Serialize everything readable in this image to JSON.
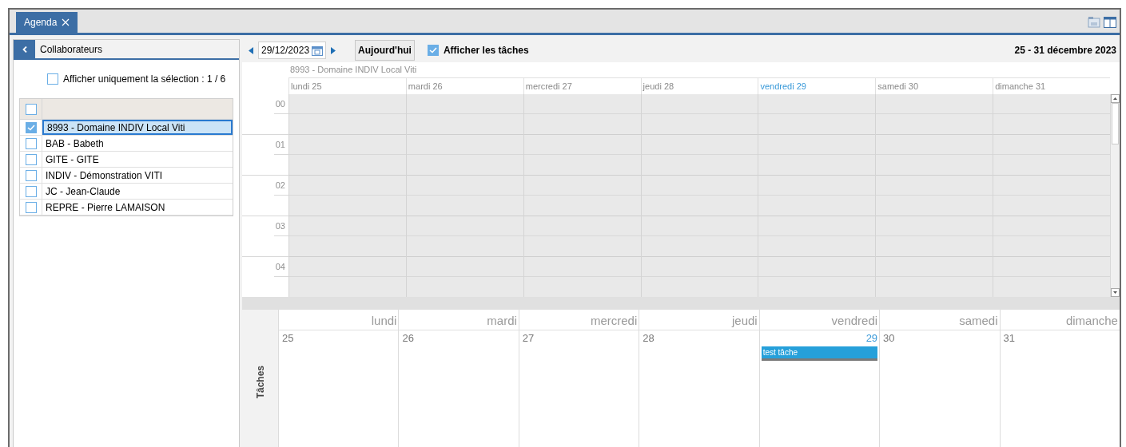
{
  "tab": {
    "label": "Agenda",
    "selected": true
  },
  "sidebar": {
    "title": "Collaborateurs",
    "show_selection_only": {
      "label": "Afficher uniquement la sélection : 1 / 6",
      "checked": false
    },
    "select_all_checked": false,
    "collaborators": [
      {
        "label": "8993 - Domaine INDIV Local Viti",
        "checked": true,
        "selected": true
      },
      {
        "label": "BAB - Babeth",
        "checked": false,
        "selected": false
      },
      {
        "label": "GITE - GITE",
        "checked": false,
        "selected": false
      },
      {
        "label": "INDIV - Démonstration VITI",
        "checked": false,
        "selected": false
      },
      {
        "label": "JC - Jean-Claude",
        "checked": false,
        "selected": false
      },
      {
        "label": "REPRE - Pierre LAMAISON",
        "checked": false,
        "selected": false
      }
    ]
  },
  "toolbar": {
    "date": "29/12/2023",
    "today_button": "Aujourd'hui",
    "show_tasks": {
      "label": "Afficher les tâches",
      "checked": true
    },
    "range": "25  - 31 décembre 2023"
  },
  "schedule": {
    "owner": "8993 - Domaine INDIV Local Viti",
    "hours": [
      "00",
      "01",
      "02",
      "03",
      "04"
    ],
    "days": [
      {
        "label": "lundi 25",
        "today": false
      },
      {
        "label": "mardi 26",
        "today": false
      },
      {
        "label": "mercredi 27",
        "today": false
      },
      {
        "label": "jeudi 28",
        "today": false
      },
      {
        "label": "vendredi 29",
        "today": true
      },
      {
        "label": "samedi 30",
        "today": false
      },
      {
        "label": "dimanche 31",
        "today": false
      }
    ]
  },
  "tasks": {
    "label": "Tâches",
    "days": [
      {
        "name": "lundi",
        "number": "25",
        "today": false
      },
      {
        "name": "mardi",
        "number": "26",
        "today": false
      },
      {
        "name": "mercredi",
        "number": "27",
        "today": false
      },
      {
        "name": "jeudi",
        "number": "28",
        "today": false
      },
      {
        "name": "vendredi",
        "number": "29",
        "today": true,
        "tasks": [
          "test tâche"
        ]
      },
      {
        "name": "samedi",
        "number": "30",
        "today": false
      },
      {
        "name": "dimanche",
        "number": "31",
        "today": false
      }
    ]
  }
}
